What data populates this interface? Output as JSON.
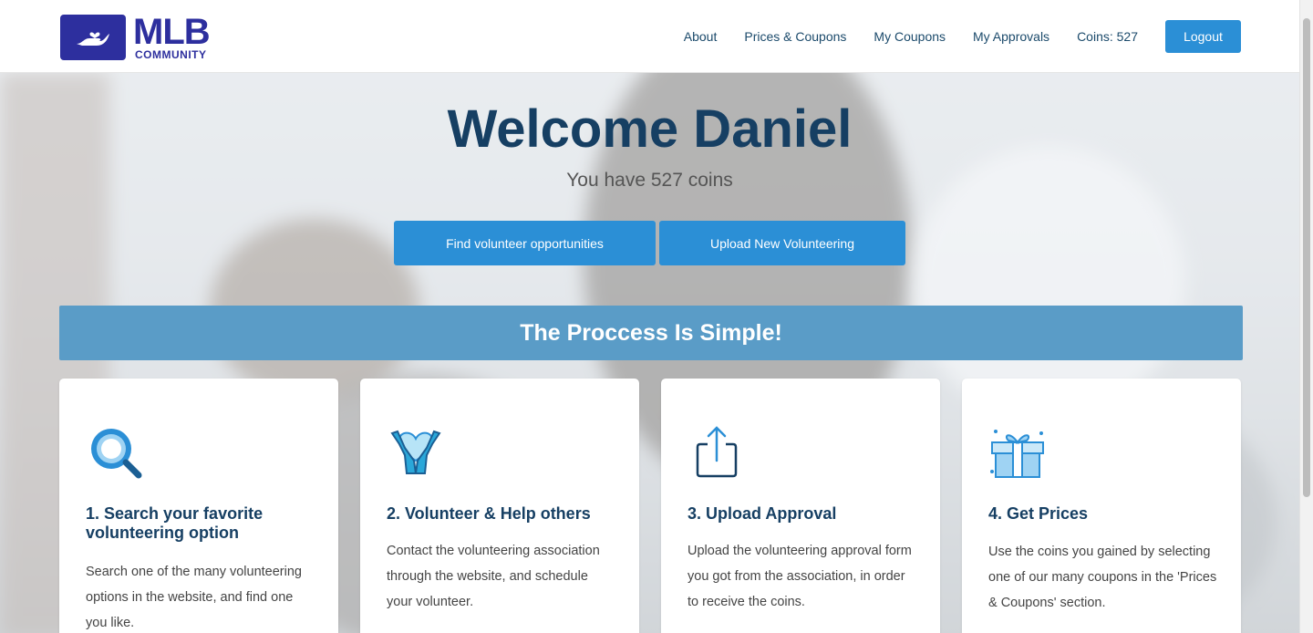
{
  "brand": {
    "main": "MLB",
    "sub": "COMMUNITY",
    "color": "#2d2f9e"
  },
  "nav": {
    "items": [
      "About",
      "Prices & Coupons",
      "My Coupons",
      "My Approvals",
      "Coins: 527"
    ],
    "logout_label": "Logout"
  },
  "hero": {
    "title": "Welcome Daniel",
    "subtitle": "You have 527 coins",
    "find_button": "Find volunteer opportunities",
    "upload_button": "Upload New Volunteering"
  },
  "banner": {
    "title": "The Proccess Is Simple!"
  },
  "steps": [
    {
      "icon": "search-icon",
      "title": "1. Search your favorite volunteering option",
      "text": "Search one of the many volunteering options in the website, and find one you like."
    },
    {
      "icon": "helping-hands-heart-icon",
      "title": "2. Volunteer & Help others",
      "text": "Contact the volunteering association through the website, and schedule your volunteer."
    },
    {
      "icon": "upload-share-icon",
      "title": "3. Upload Approval",
      "text": "Upload the volunteering approval form you got from the association, in order to receive the coins."
    },
    {
      "icon": "gift-icon",
      "title": "4. Get Prices",
      "text": "Use the coins you gained by selecting one of our many coupons in the 'Prices & Coupons' section."
    }
  ],
  "colors": {
    "accent": "#2b8fd6",
    "heading": "#163f63",
    "banner": "#5a9cc7"
  }
}
